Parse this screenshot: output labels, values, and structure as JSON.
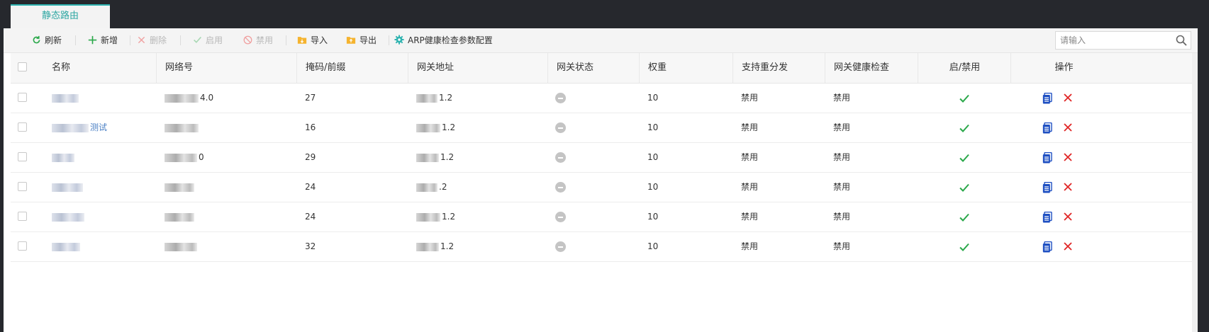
{
  "tab": {
    "label": "静态路由"
  },
  "toolbar": {
    "refresh": "刷新",
    "add": "新增",
    "delete": "删除",
    "enable": "启用",
    "disable": "禁用",
    "import": "导入",
    "export": "导出",
    "arp_config": "ARP健康检查参数配置",
    "search_placeholder": "请输入"
  },
  "table": {
    "columns": [
      "名称",
      "网络号",
      "掩码/前缀",
      "网关地址",
      "网关状态",
      "权重",
      "支持重分发",
      "网关健康检查",
      "启/禁用",
      "操作"
    ],
    "rows": [
      {
        "name_suffix": "",
        "network_suffix": "4.0",
        "mask": "27",
        "gateway_suffix": "1.2",
        "weight": "10",
        "redistribute": "禁用",
        "health_check": "禁用"
      },
      {
        "name_suffix": "测试",
        "network_suffix": "",
        "mask": "16",
        "gateway_suffix": "1.2",
        "weight": "10",
        "redistribute": "禁用",
        "health_check": "禁用"
      },
      {
        "name_suffix": "",
        "network_suffix": "0",
        "mask": "29",
        "gateway_suffix": "1.2",
        "weight": "10",
        "redistribute": "禁用",
        "health_check": "禁用"
      },
      {
        "name_suffix": "",
        "network_suffix": "",
        "mask": "24",
        "gateway_suffix": ".2",
        "weight": "10",
        "redistribute": "禁用",
        "health_check": "禁用"
      },
      {
        "name_suffix": "",
        "network_suffix": "",
        "mask": "24",
        "gateway_suffix": "1.2",
        "weight": "10",
        "redistribute": "禁用",
        "health_check": "禁用"
      },
      {
        "name_suffix": "",
        "network_suffix": "",
        "mask": "32",
        "gateway_suffix": "1.2",
        "weight": "10",
        "redistribute": "禁用",
        "health_check": "禁用"
      }
    ]
  },
  "colors": {
    "accent": "#2fb3b0",
    "check_green": "#2aa84a",
    "delete_red": "#e02525",
    "copy_blue": "#1e4fc2",
    "link_blue": "#4a7fc4"
  },
  "icons": {
    "refresh": "refresh-icon",
    "add": "plus-icon",
    "delete": "x-icon",
    "enable": "check-icon",
    "disable": "ban-icon",
    "import": "folder-import-icon",
    "export": "folder-export-icon",
    "arp_config": "gear-icon",
    "search": "search-icon",
    "gateway_status": "minus-circle-icon",
    "enabled": "check-icon",
    "copy": "copy-icon",
    "row_delete": "x-icon"
  }
}
